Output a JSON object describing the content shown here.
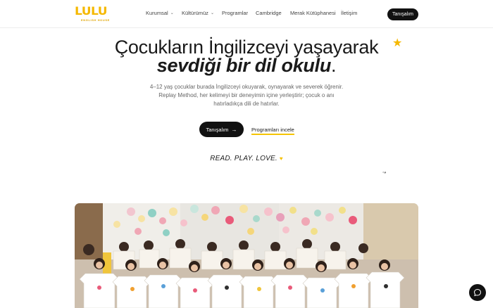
{
  "brand": {
    "logo_text": "LULU",
    "logo_sub": "ENGLISH HOUSE",
    "accent": "#f5b800"
  },
  "nav": {
    "items": [
      {
        "label": "Kurumsal",
        "has_dropdown": true
      },
      {
        "label": "Kültürümüz",
        "has_dropdown": true
      },
      {
        "label": "Programlar",
        "has_dropdown": false
      },
      {
        "label": "Cambridge",
        "has_dropdown": false
      },
      {
        "label": "Merak Kütüphanesi",
        "has_dropdown": false
      },
      {
        "label": "İletişim",
        "has_dropdown": false
      }
    ],
    "cta_label": "Tanışalım"
  },
  "hero": {
    "title_line1": "Çocukların İngilizceyi yaşayarak",
    "title_line2_emphasis": "sevdiği bir dil okulu",
    "title_line2_suffix": ".",
    "description": "4–12 yaş çocuklar burada İngilizceyi okuyarak, oynayarak ve severek öğrenir. Replay Method, her kelimeyi bir deneyimin içine yerleştirir; çocuk o anı hatırladıkça dili de hatırlar.",
    "primary_button": "Tanışalım",
    "primary_button_arrow": "→",
    "secondary_link": "Programları incele",
    "slogan": "READ. PLAY. LOVE.",
    "slogan_icon": "yellow-heart-icon"
  },
  "photo": {
    "subject": "children-holding-painted-tshirts"
  },
  "chat": {
    "icon": "chat-bubble-icon"
  }
}
